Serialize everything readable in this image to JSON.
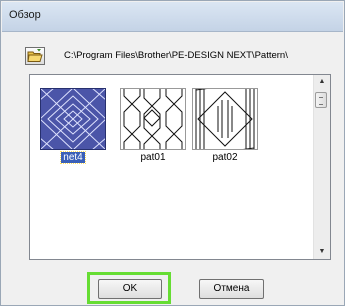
{
  "dialog": {
    "title": "Обзор"
  },
  "toolbar": {
    "path": "C:\\Program Files\\Brother\\PE-DESIGN NEXT\\Pattern\\",
    "folder_icon": "open-folder-icon"
  },
  "files": [
    {
      "name": "net4",
      "selected": true
    },
    {
      "name": "pat01",
      "selected": false
    },
    {
      "name": "pat02",
      "selected": false
    }
  ],
  "buttons": {
    "ok": "OK",
    "cancel": "Отмена"
  },
  "colors": {
    "selection": "#3a5fb8",
    "focus_highlight": "#66dd33"
  }
}
